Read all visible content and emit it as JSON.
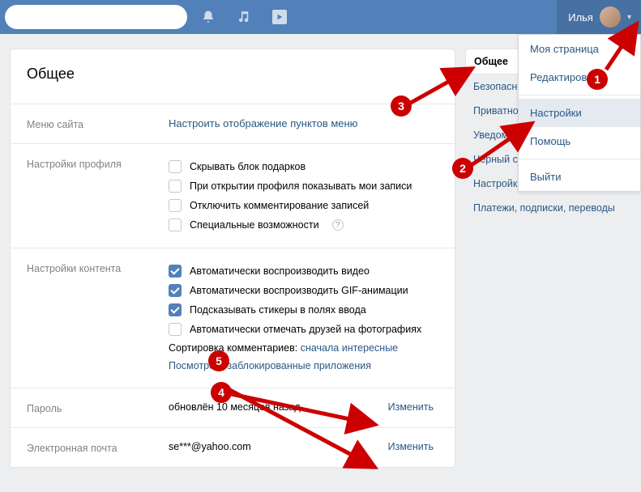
{
  "header": {
    "search_placeholder": "",
    "user_name": "Илья"
  },
  "dropdown": {
    "items": [
      {
        "label": "Моя страница",
        "hl": false
      },
      {
        "label": "Редактировать",
        "hl": false
      },
      {
        "label": "Настройки",
        "hl": true
      },
      {
        "label": "Помощь",
        "hl": false
      },
      {
        "label": "Выйти",
        "hl": false
      }
    ]
  },
  "card": {
    "title": "Общее",
    "menu_label": "Меню сайта",
    "menu_link": "Настроить отображение пунктов меню",
    "profile_label": "Настройки профиля",
    "profile_opts": [
      {
        "label": "Скрывать блок подарков",
        "checked": false,
        "help": false
      },
      {
        "label": "При открытии профиля показывать мои записи",
        "checked": false,
        "help": false
      },
      {
        "label": "Отключить комментирование записей",
        "checked": false,
        "help": false
      },
      {
        "label": "Специальные возможности",
        "checked": false,
        "help": true
      }
    ],
    "content_label": "Настройки контента",
    "content_opts": [
      {
        "label": "Автоматически воспроизводить видео",
        "checked": true
      },
      {
        "label": "Автоматически воспроизводить GIF-анимации",
        "checked": true
      },
      {
        "label": "Подсказывать стикеры в полях ввода",
        "checked": true
      },
      {
        "label": "Автоматически отмечать друзей на фотографиях",
        "checked": false
      }
    ],
    "sort_prefix": "Сортировка комментариев: ",
    "sort_link": "сначала интересные",
    "blocked_link": "Посмотреть заблокированные приложения",
    "password_label": "Пароль",
    "password_value": "обновлён 10 месяцев назад",
    "email_label": "Электронная почта",
    "email_value": "se***@yahoo.com",
    "change": "Изменить"
  },
  "side": {
    "items": [
      {
        "label": "Общее",
        "active": true
      },
      {
        "label": "Безопасность",
        "active": false
      },
      {
        "label": "Приватность",
        "active": false
      },
      {
        "label": "Уведомления",
        "active": false
      },
      {
        "label": "Чёрный список",
        "active": false
      },
      {
        "label": "Настройки приложений",
        "active": false
      },
      {
        "label": "Платежи, подписки, переводы",
        "active": false
      }
    ]
  },
  "annotations": [
    "1",
    "2",
    "3",
    "4",
    "5"
  ]
}
